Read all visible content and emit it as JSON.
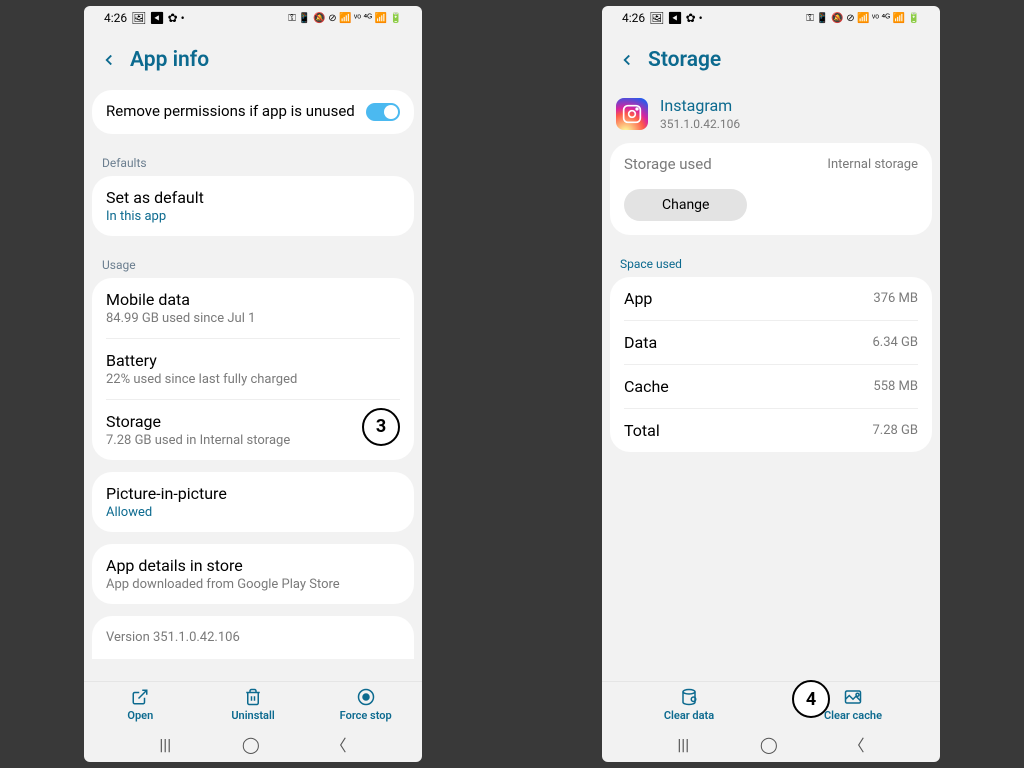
{
  "statusbar": {
    "time": "4:26",
    "icons_left": "🖼 ◀ ✿ •",
    "icons_right": "⚿ 📱 🔕 ⊘ 📶 ᵛᵒ ⁴ᴳ 📶 🔋"
  },
  "left": {
    "title": "App info",
    "remove_perms": "Remove permissions if app is unused",
    "defaults_label": "Defaults",
    "set_default_title": "Set as default",
    "set_default_sub": "In this app",
    "usage_label": "Usage",
    "mobile_data_title": "Mobile data",
    "mobile_data_sub": "84.99 GB used since Jul 1",
    "battery_title": "Battery",
    "battery_sub": "22% used since last fully charged",
    "storage_title": "Storage",
    "storage_sub": "7.28 GB used in Internal storage",
    "storage_badge": "3",
    "pip_title": "Picture-in-picture",
    "pip_sub": "Allowed",
    "details_title": "App details in store",
    "details_sub": "App downloaded from Google Play Store",
    "version": "Version 351.1.0.42.106",
    "actions": {
      "open": "Open",
      "uninstall": "Uninstall",
      "force_stop": "Force stop"
    }
  },
  "right": {
    "title": "Storage",
    "app_name": "Instagram",
    "app_version": "351.1.0.42.106",
    "storage_used_label": "Storage used",
    "storage_used_location": "Internal storage",
    "change_btn": "Change",
    "space_used_label": "Space used",
    "rows": {
      "app": {
        "label": "App",
        "value": "376 MB"
      },
      "data": {
        "label": "Data",
        "value": "6.34 GB"
      },
      "cache": {
        "label": "Cache",
        "value": "558 MB"
      },
      "total": {
        "label": "Total",
        "value": "7.28 GB"
      }
    },
    "badge": "4",
    "actions": {
      "clear_data": "Clear data",
      "clear_cache": "Clear cache"
    }
  }
}
